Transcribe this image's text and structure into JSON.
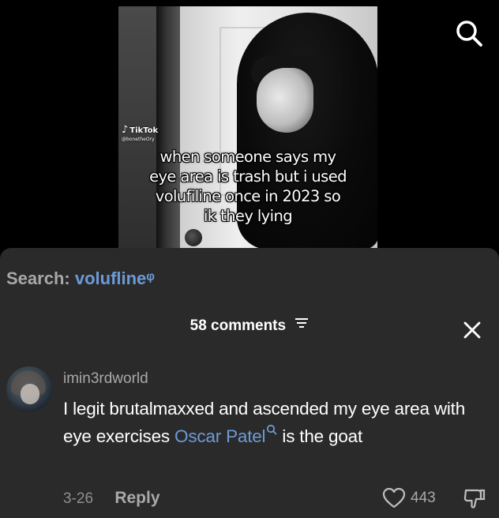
{
  "video": {
    "watermark": "TikTok",
    "handle": "@bonetheOry",
    "caption": "when someone says my\neye area is trash but i used\nvolufiline once in 2023 so\nik they lying"
  },
  "search": {
    "label": "Search:",
    "query": "voluflineᵠ"
  },
  "comments_panel": {
    "count_label": "58 comments"
  },
  "comment": {
    "username": "imin3rdworld",
    "text_part1": "I legit brutalmaxxed and ascended my eye area with eye exercises ",
    "mention": "Oscar Patel",
    "text_part2": " is the goat",
    "date": "3-26",
    "reply_label": "Reply",
    "likes": "443"
  },
  "icons": {
    "top_search": "search-icon",
    "sort": "sort-lines-icon",
    "close": "close-icon",
    "like": "heart-icon",
    "dislike": "thumbs-down-icon"
  },
  "colors": {
    "accent_link": "#6b9bd8",
    "sheet_bg": "#2a2a2a"
  }
}
